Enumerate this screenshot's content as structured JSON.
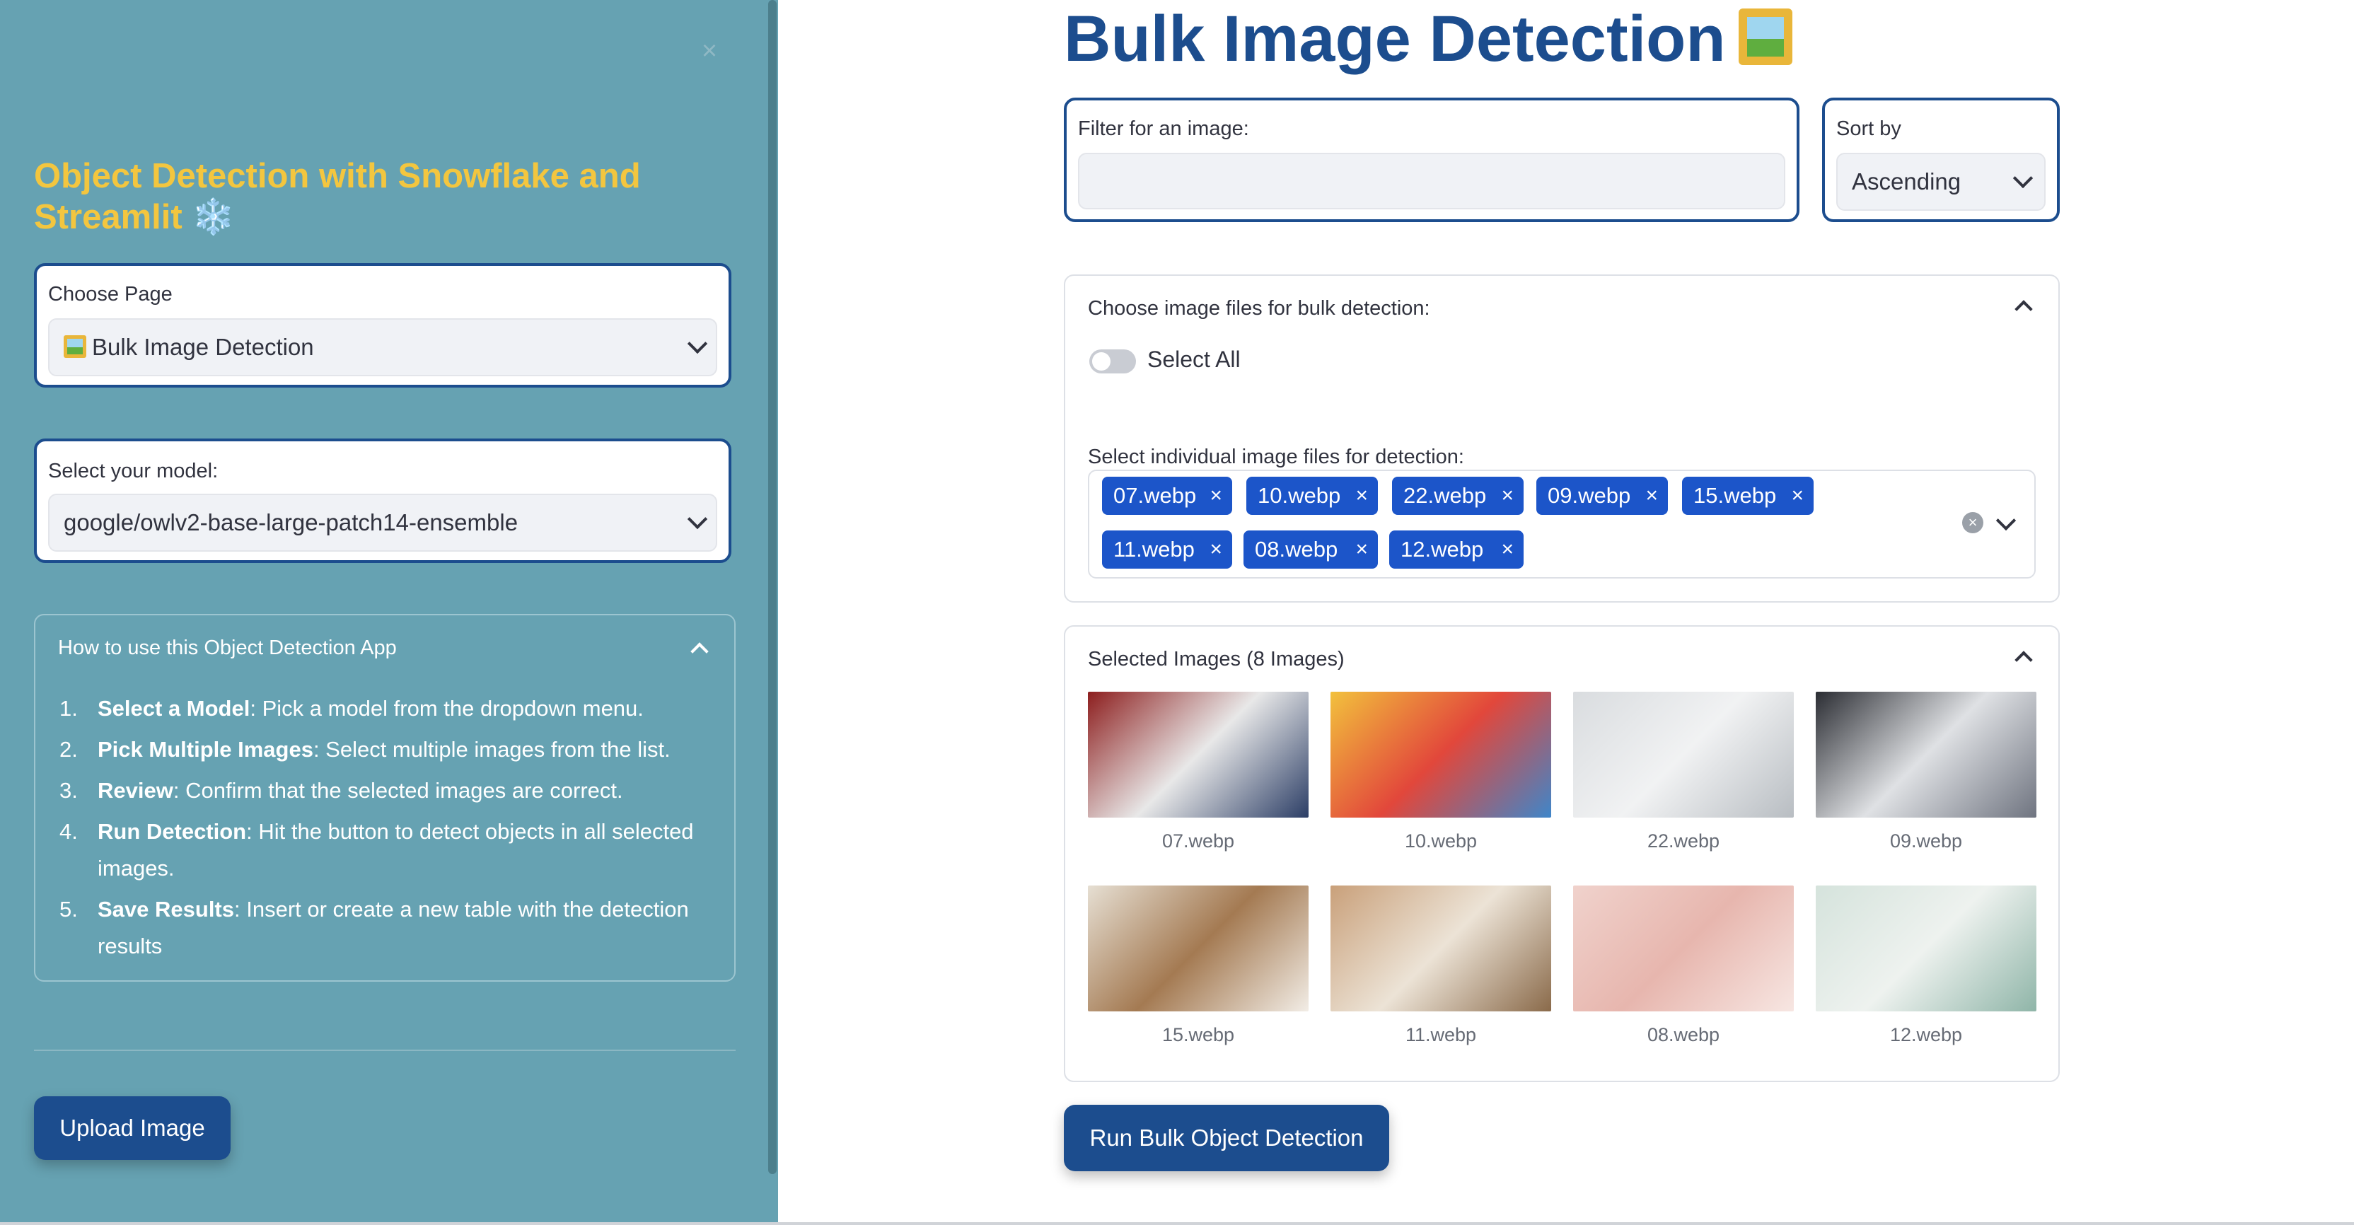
{
  "sidebar": {
    "close_icon": "close-icon",
    "title": "Object Detection with Snowflake and Streamlit ❄️",
    "page_select": {
      "label": "Choose Page",
      "value": "Bulk Image Detection",
      "icon": "framed-picture-icon"
    },
    "model_select": {
      "label": "Select your model:",
      "value": "google/owlv2-base-large-patch14-ensemble"
    },
    "howto": {
      "title": "How to use this Object Detection App",
      "steps": [
        {
          "num": "1.",
          "bold": "Select a Model",
          "text": ": Pick a model from the dropdown menu."
        },
        {
          "num": "2.",
          "bold": "Pick Multiple Images",
          "text": ": Select multiple images from the list."
        },
        {
          "num": "3.",
          "bold": "Review",
          "text": ": Confirm that the selected images are correct."
        },
        {
          "num": "4.",
          "bold": "Run Detection",
          "text": ": Hit the button to detect objects in all selected images."
        },
        {
          "num": "5.",
          "bold": "Save Results",
          "text": ": Insert or create a new table with the detection results"
        }
      ]
    },
    "upload_button": "Upload Image"
  },
  "main": {
    "title": "Bulk Image Detection",
    "title_icon": "framed-picture-icon",
    "filter": {
      "label": "Filter for an image:",
      "value": "",
      "placeholder": ""
    },
    "sort": {
      "label": "Sort by",
      "value": "Ascending"
    },
    "files_expander": {
      "title": "Choose image files for bulk detection:",
      "select_all": {
        "label": "Select All",
        "checked": false
      },
      "multiselect_label": "Select individual image files for detection:",
      "tags": [
        "07.webp",
        "10.webp",
        "22.webp",
        "09.webp",
        "15.webp",
        "11.webp",
        "08.webp",
        "12.webp"
      ]
    },
    "selected_expander": {
      "title": "Selected Images (8 Images)",
      "images": [
        {
          "caption": "07.webp",
          "colors": [
            "#8d1e1e",
            "#e8e8e8",
            "#2c3e66"
          ]
        },
        {
          "caption": "10.webp",
          "colors": [
            "#f2c13d",
            "#e2473b",
            "#3f86c9"
          ]
        },
        {
          "caption": "22.webp",
          "colors": [
            "#d9dcdf",
            "#f1f2f3",
            "#b8bdc2"
          ]
        },
        {
          "caption": "09.webp",
          "colors": [
            "#2b2d33",
            "#dfe1e4",
            "#6f7480"
          ]
        },
        {
          "caption": "15.webp",
          "colors": [
            "#e6dfd3",
            "#a47a52",
            "#f2ede6"
          ]
        },
        {
          "caption": "11.webp",
          "colors": [
            "#c9a07a",
            "#ece3d6",
            "#8a6a4a"
          ]
        },
        {
          "caption": "08.webp",
          "colors": [
            "#f0d2cc",
            "#e7b6ae",
            "#f7e6e2"
          ]
        },
        {
          "caption": "12.webp",
          "colors": [
            "#d5e3dc",
            "#eef2ef",
            "#8fb5a8"
          ]
        }
      ]
    },
    "run_button": "Run Bulk Object Detection"
  }
}
